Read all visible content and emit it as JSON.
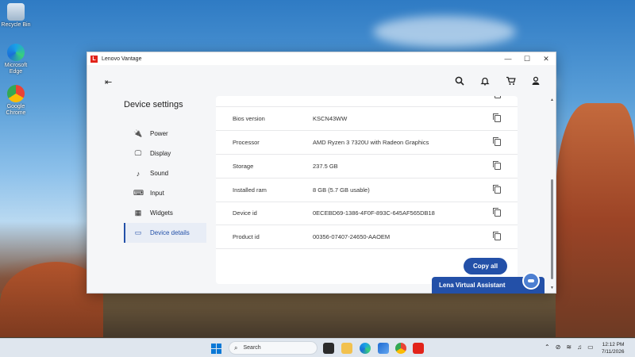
{
  "desktop": {
    "icons": [
      {
        "label": "Recycle Bin",
        "icon": "recycle-bin-icon"
      },
      {
        "label": "Microsoft Edge",
        "icon": "edge-icon"
      },
      {
        "label": "Google Chrome",
        "icon": "chrome-icon"
      }
    ]
  },
  "window": {
    "title": "Lenovo Vantage",
    "logo_letter": "L",
    "controls": {
      "minimize": "—",
      "maximize": "☐",
      "close": "✕"
    }
  },
  "topbar": {
    "menu_icon": "menu-collapse-icon",
    "icons": [
      "search-icon",
      "bell-icon",
      "cart-icon",
      "user-icon"
    ]
  },
  "sidebar": {
    "title": "Device settings",
    "items": [
      {
        "label": "Power",
        "icon": "plug-icon",
        "glyph": "🔌"
      },
      {
        "label": "Display",
        "icon": "monitor-icon",
        "glyph": "🖵"
      },
      {
        "label": "Sound",
        "icon": "music-note-icon",
        "glyph": "♪"
      },
      {
        "label": "Input",
        "icon": "keyboard-icon",
        "glyph": "⌨"
      },
      {
        "label": "Widgets",
        "icon": "widgets-icon",
        "glyph": "▦"
      },
      {
        "label": "Device details",
        "icon": "laptop-icon",
        "glyph": "▭",
        "active": true
      }
    ]
  },
  "details": {
    "rows": [
      {
        "label": "Bios version",
        "value": "KSCN43WW"
      },
      {
        "label": "Processor",
        "value": "AMD Ryzen 3 7320U with Radeon Graphics"
      },
      {
        "label": "Storage",
        "value": "237.5 GB"
      },
      {
        "label": "Installed ram",
        "value": "8 GB (5.7 GB usable)"
      },
      {
        "label": "Device id",
        "value": "0ECEBD69-1386-4F0F-893C-645AF565DB18"
      },
      {
        "label": "Product id",
        "value": "00356-07407-24650-AAOEM"
      }
    ],
    "copy_all_label": "Copy all"
  },
  "assistant": {
    "label": "Lena Virtual Assistant"
  },
  "taskbar": {
    "search_placeholder": "Search",
    "tray": {
      "time": "12:12 PM",
      "date": "7/11/2026"
    }
  },
  "colors": {
    "accent": "#2350a8",
    "lenovo_red": "#e2231a"
  }
}
